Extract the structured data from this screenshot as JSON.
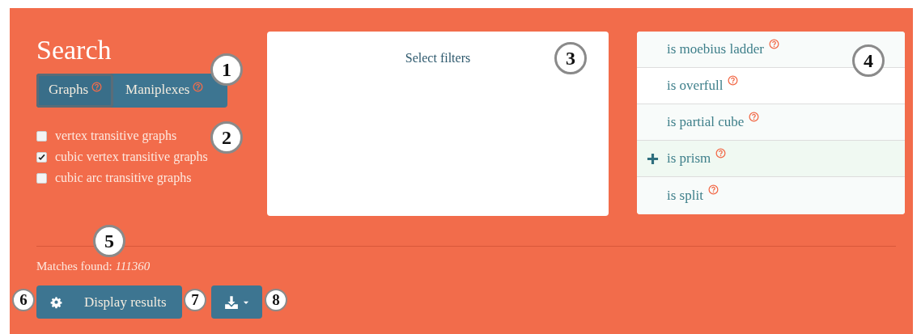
{
  "heading": "Search",
  "tabs": [
    {
      "label": "Graphs",
      "selected": true
    },
    {
      "label": "Maniplexes",
      "selected": false
    }
  ],
  "collections": [
    {
      "label": "vertex transitive graphs",
      "checked": false
    },
    {
      "label": "cubic vertex transitive graphs",
      "checked": true
    },
    {
      "label": "cubic arc transitive graphs",
      "checked": false
    }
  ],
  "filters_panel": {
    "placeholder": "Select filters"
  },
  "filter_options": [
    {
      "label": "is moebius ladder",
      "highlighted": false
    },
    {
      "label": "is overfull",
      "highlighted": false
    },
    {
      "label": "is partial cube",
      "highlighted": false
    },
    {
      "label": "is prism",
      "highlighted": true
    },
    {
      "label": "is split",
      "highlighted": false
    }
  ],
  "matches": {
    "label": "Matches found:",
    "count": "111360"
  },
  "display_button": {
    "label": "Display results"
  },
  "callouts": [
    "1",
    "2",
    "3",
    "4",
    "5",
    "6",
    "7",
    "8"
  ]
}
